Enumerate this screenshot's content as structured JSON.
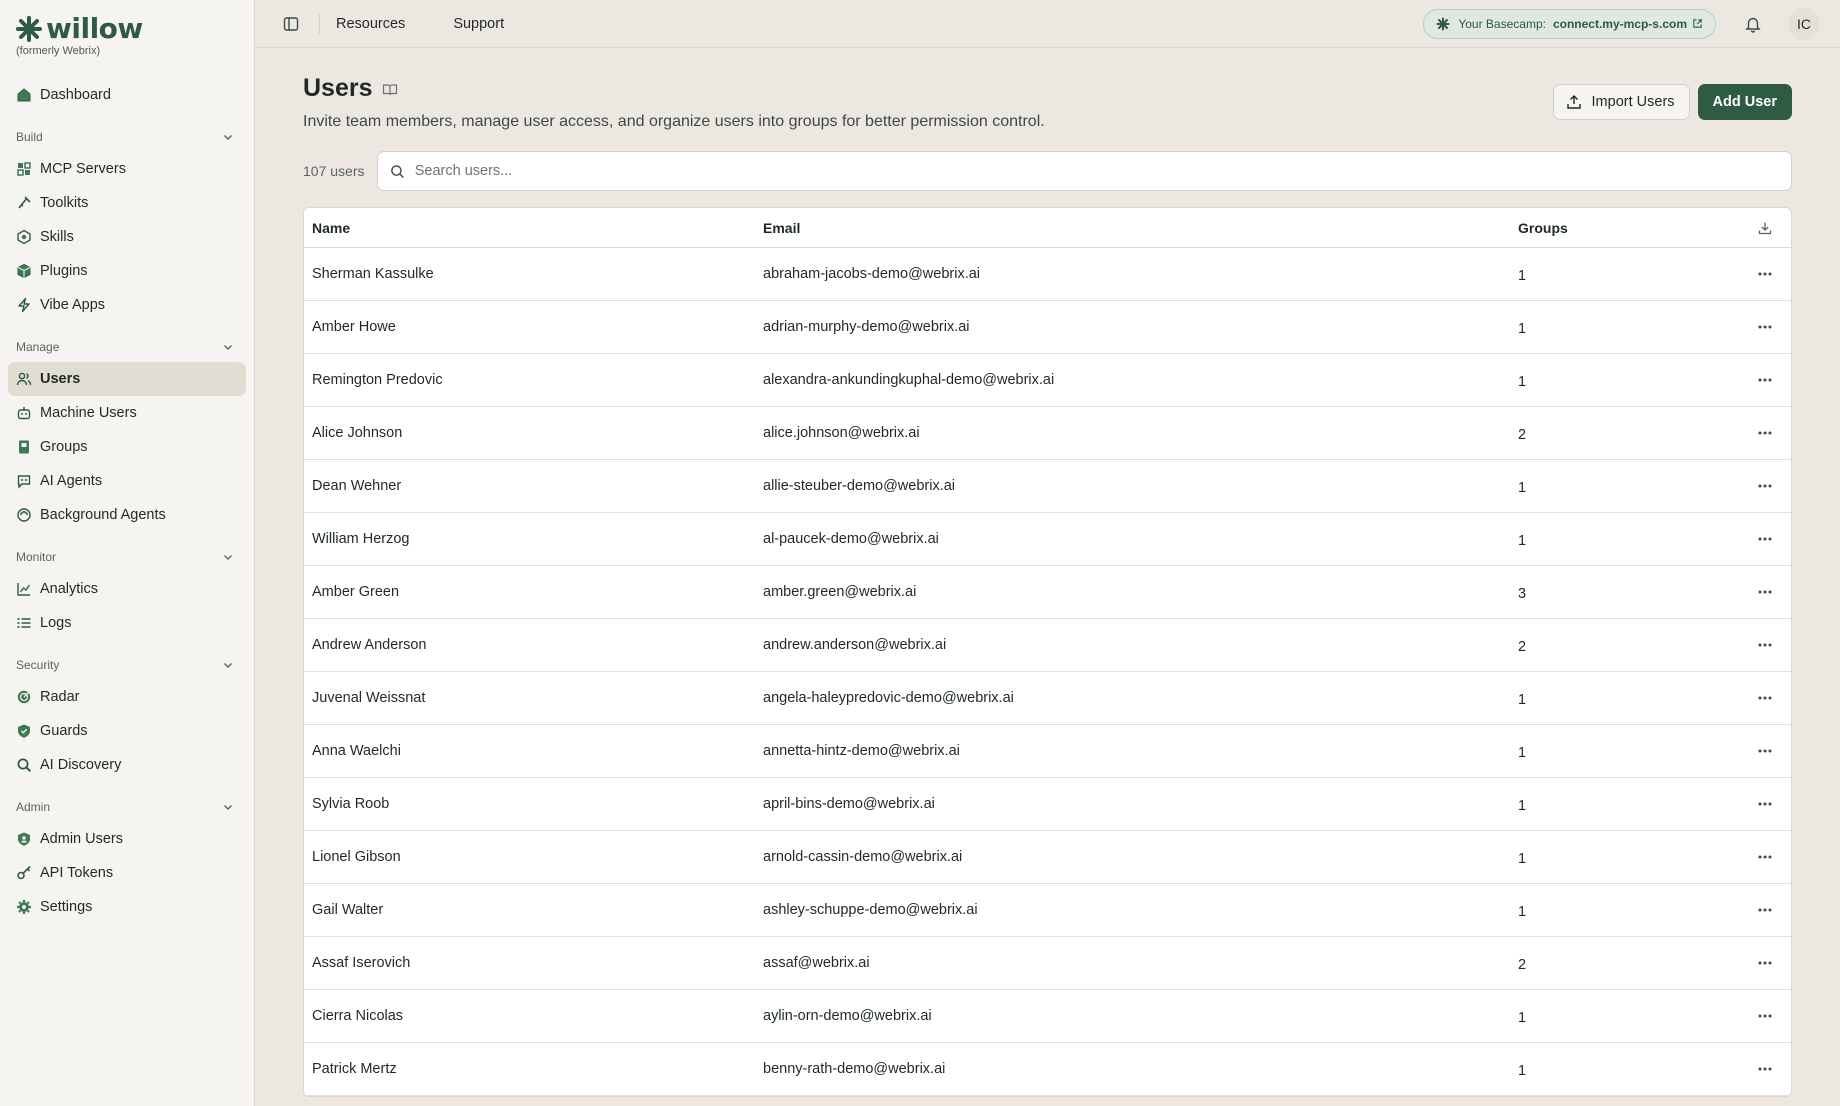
{
  "brand": {
    "name": "willow",
    "sub": "(formerly Webrix)",
    "color": "#2f5a43"
  },
  "sidebar": {
    "dashboard": {
      "label": "Dashboard",
      "icon": "home-icon"
    },
    "sections": [
      {
        "label": "Build",
        "items": [
          {
            "label": "MCP Servers",
            "icon": "mcp-servers-icon"
          },
          {
            "label": "Toolkits",
            "icon": "toolkit-icon"
          },
          {
            "label": "Skills",
            "icon": "skills-icon"
          },
          {
            "label": "Plugins",
            "icon": "plugin-icon"
          },
          {
            "label": "Vibe Apps",
            "icon": "bolt-icon"
          }
        ]
      },
      {
        "label": "Manage",
        "items": [
          {
            "label": "Users",
            "icon": "users-icon",
            "active": true
          },
          {
            "label": "Machine Users",
            "icon": "robot-icon"
          },
          {
            "label": "Groups",
            "icon": "groups-icon"
          },
          {
            "label": "AI Agents",
            "icon": "agent-icon"
          },
          {
            "label": "Background Agents",
            "icon": "background-agent-icon"
          }
        ]
      },
      {
        "label": "Monitor",
        "items": [
          {
            "label": "Analytics",
            "icon": "chart-icon"
          },
          {
            "label": "Logs",
            "icon": "list-icon"
          }
        ]
      },
      {
        "label": "Security",
        "items": [
          {
            "label": "Radar",
            "icon": "radar-icon"
          },
          {
            "label": "Guards",
            "icon": "shield-icon"
          },
          {
            "label": "AI Discovery",
            "icon": "search-icon"
          }
        ]
      },
      {
        "label": "Admin",
        "items": [
          {
            "label": "Admin Users",
            "icon": "admin-shield-icon"
          },
          {
            "label": "API Tokens",
            "icon": "key-icon"
          },
          {
            "label": "Settings",
            "icon": "gear-icon"
          }
        ]
      }
    ]
  },
  "topbar": {
    "links": [
      "Resources",
      "Support"
    ],
    "basecamp_label": "Your Basecamp:",
    "basecamp_url": "connect.my-mcp-s.com",
    "avatar_initials": "IC"
  },
  "page": {
    "title": "Users",
    "subtitle": "Invite team members, manage user access, and organize users into groups for better permission control.",
    "import_label": "Import Users",
    "add_label": "Add User",
    "count": "107 users",
    "search_placeholder": "Search users..."
  },
  "table": {
    "columns": [
      "Name",
      "Email",
      "Groups"
    ],
    "rows": [
      {
        "name": "Sherman Kassulke",
        "email": "abraham-jacobs-demo@webrix.ai",
        "groups": "1"
      },
      {
        "name": "Amber Howe",
        "email": "adrian-murphy-demo@webrix.ai",
        "groups": "1"
      },
      {
        "name": "Remington Predovic",
        "email": "alexandra-ankundingkuphal-demo@webrix.ai",
        "groups": "1"
      },
      {
        "name": "Alice Johnson",
        "email": "alice.johnson@webrix.ai",
        "groups": "2"
      },
      {
        "name": "Dean Wehner",
        "email": "allie-steuber-demo@webrix.ai",
        "groups": "1"
      },
      {
        "name": "William Herzog",
        "email": "al-paucek-demo@webrix.ai",
        "groups": "1"
      },
      {
        "name": "Amber Green",
        "email": "amber.green@webrix.ai",
        "groups": "3"
      },
      {
        "name": "Andrew Anderson",
        "email": "andrew.anderson@webrix.ai",
        "groups": "2"
      },
      {
        "name": "Juvenal Weissnat",
        "email": "angela-haleypredovic-demo@webrix.ai",
        "groups": "1"
      },
      {
        "name": "Anna Waelchi",
        "email": "annetta-hintz-demo@webrix.ai",
        "groups": "1"
      },
      {
        "name": "Sylvia Roob",
        "email": "april-bins-demo@webrix.ai",
        "groups": "1"
      },
      {
        "name": "Lionel Gibson",
        "email": "arnold-cassin-demo@webrix.ai",
        "groups": "1"
      },
      {
        "name": "Gail Walter",
        "email": "ashley-schuppe-demo@webrix.ai",
        "groups": "1"
      },
      {
        "name": "Assaf Iserovich",
        "email": "assaf@webrix.ai",
        "groups": "2"
      },
      {
        "name": "Cierra Nicolas",
        "email": "aylin-orn-demo@webrix.ai",
        "groups": "1"
      },
      {
        "name": "Patrick Mertz",
        "email": "benny-rath-demo@webrix.ai",
        "groups": "1"
      }
    ]
  }
}
